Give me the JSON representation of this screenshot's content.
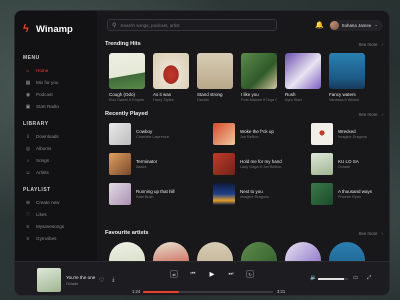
{
  "app": {
    "name": "Winamp"
  },
  "sidebar": {
    "menu_title": "MENU",
    "menu": [
      {
        "label": "Home",
        "icon": "home-icon"
      },
      {
        "label": "Mix for you",
        "icon": "mix-icon"
      },
      {
        "label": "Podcast",
        "icon": "podcast-icon"
      },
      {
        "label": "Start Radio",
        "icon": "radio-icon"
      }
    ],
    "library_title": "LIBRARY",
    "library": [
      {
        "label": "Downloads",
        "icon": "download-icon"
      },
      {
        "label": "Albums",
        "icon": "album-icon"
      },
      {
        "label": "Songs",
        "icon": "song-icon"
      },
      {
        "label": "Artists",
        "icon": "artist-icon"
      }
    ],
    "playlist_title": "PLAYLIST",
    "playlist": [
      {
        "label": "Create new",
        "icon": "plus-icon"
      },
      {
        "label": "Likes",
        "icon": "heart-icon"
      },
      {
        "label": "Mysavesongs",
        "icon": "save-icon"
      },
      {
        "label": "Gymvibes",
        "icon": "list-icon"
      }
    ]
  },
  "topbar": {
    "search_placeholder": "Search songs, podcast, artist",
    "user_name": "Sohana Jamee"
  },
  "trending": {
    "title": "Trending Hits",
    "see_more": "See more",
    "items": [
      {
        "title": "Cough (Odo)",
        "artist": "Kizz Daniel ft Empire"
      },
      {
        "title": "As it was",
        "artist": "Harry Styles"
      },
      {
        "title": "Stand strong",
        "artist": "Davido"
      },
      {
        "title": "I like you",
        "artist": "Post Malone ft Doja Cat"
      },
      {
        "title": "Rush",
        "artist": "Ayra Starr"
      },
      {
        "title": "Fancy waters",
        "artist": "Vanessa ft Wizkid"
      }
    ]
  },
  "recent": {
    "title": "Recently Played",
    "see_more": "See more",
    "items": [
      {
        "title": "Cowboy",
        "artist": "Charlotte Lawrence"
      },
      {
        "title": "Woke the f*ck up",
        "artist": "Jon Bellion"
      },
      {
        "title": "Wrecked",
        "artist": "Imagine Dragons"
      },
      {
        "title": "Terminator",
        "artist": "Asake"
      },
      {
        "title": "Hold me for my hand",
        "artist": "Lady Gaga ft Jon Bellion"
      },
      {
        "title": "KU LO SA",
        "artist": "Oxlade"
      },
      {
        "title": "Running up that hill",
        "artist": "Kate Bush"
      },
      {
        "title": "Next to you",
        "artist": "Imagine Dragons"
      },
      {
        "title": "A thousand ways",
        "artist": "Phoebe Ryan"
      }
    ]
  },
  "favourite": {
    "title": "Favourite artists",
    "see_more": "See more"
  },
  "player": {
    "title": "You're the one",
    "artist": "Oxlade",
    "current": "1:24",
    "duration": "3:21",
    "progress": 0.28,
    "volume": 0.85
  },
  "colors": {
    "accent": "#e8432e"
  }
}
